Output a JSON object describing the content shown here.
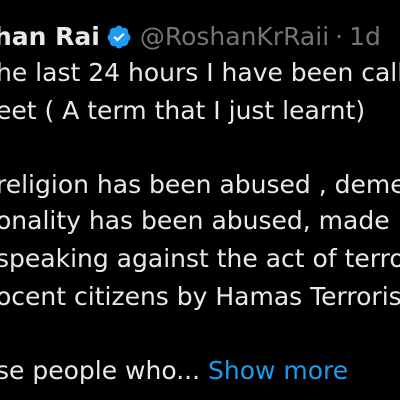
{
  "tweet": {
    "author": {
      "display_name": "han Rai",
      "handle": "@RoshanKrRaii",
      "separator": "·",
      "timestamp": "1d",
      "verified": true,
      "badge_color": "#1d9bf0"
    },
    "lines": [
      "he last 24 hours I have been call",
      "eet ( A term that I just learnt)",
      "",
      "religion has been abused , deme",
      "onality has been abused, made",
      "speaking against the act of terro",
      "ocent citizens by Hamas Terroris",
      "",
      "se people who... "
    ],
    "show_more_label": "Show more"
  },
  "colors": {
    "background": "#000000",
    "text": "#e7e9ea",
    "muted": "#71767b",
    "link": "#1d9bf0"
  }
}
